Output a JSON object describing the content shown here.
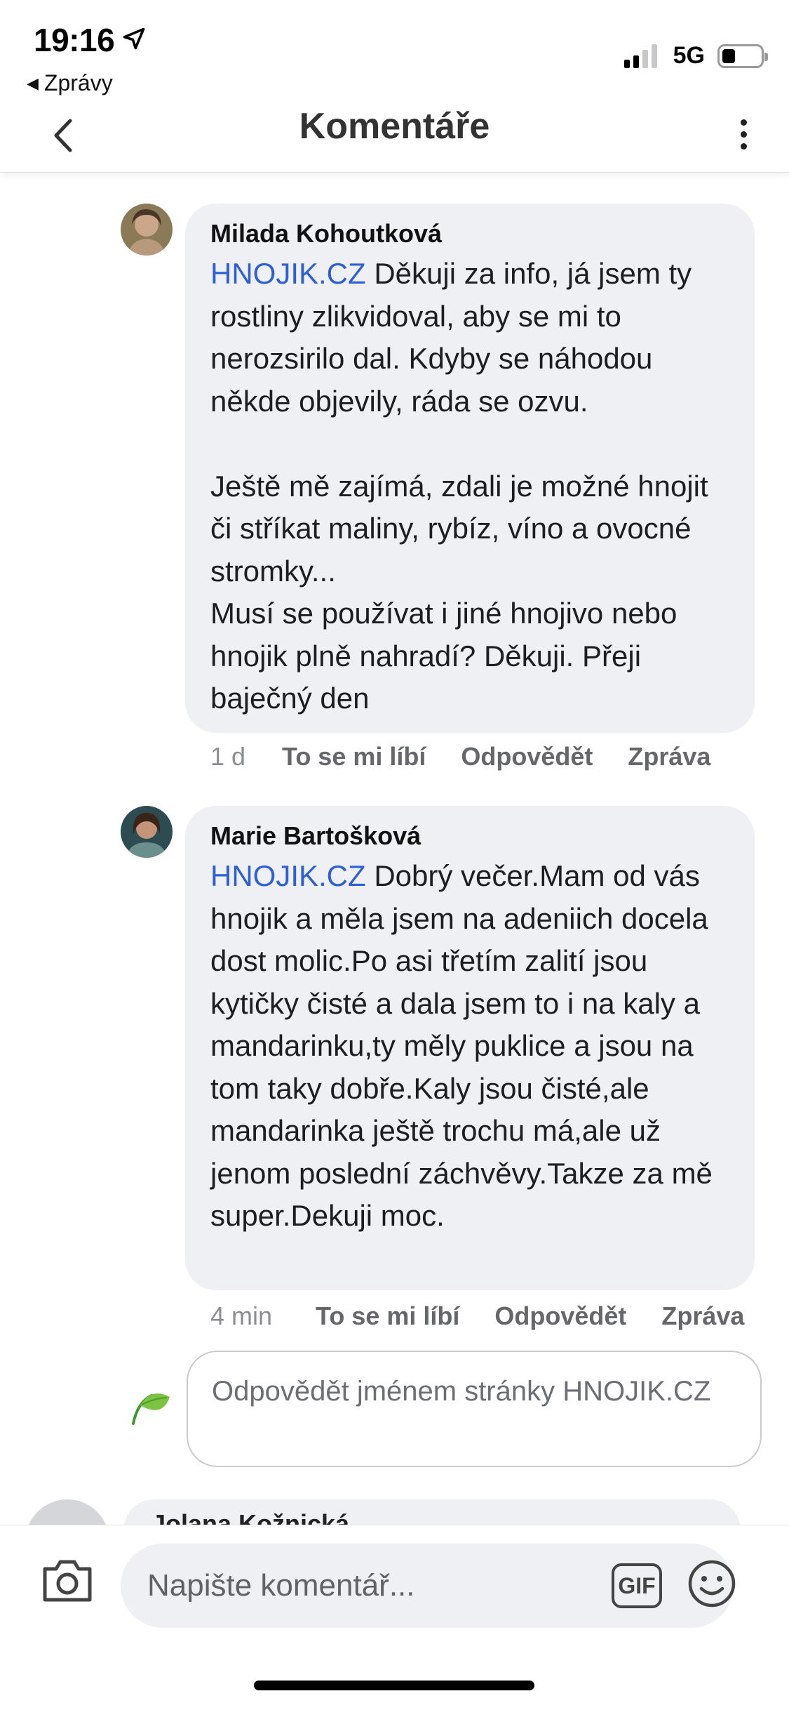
{
  "status_bar": {
    "time": "19:16",
    "back_app": "Zprávy",
    "network": "5G"
  },
  "header": {
    "title": "Komentáře"
  },
  "comments": [
    {
      "author": "Milada Kohoutková",
      "tag": "HNOJIK.CZ",
      "text": " Děkuji za info, já jsem ty rostliny zlikvidoval, aby se mi to nerozsirilo dal. Kdyby se náhodou někde objevily, ráda se ozvu.\n\nJeště mě zajímá, zdali je možné hnojit či stříkat maliny, rybíz, víno a ovocné stromky...\nMusí se používat i jiné hnojivo nebo hnojik plně nahradí? Děkuji. Přeji baječný den",
      "time": "1 d",
      "like": "To se mi líbí",
      "reply": "Odpovědět",
      "message": "Zpráva"
    },
    {
      "author": "Marie Bartošková",
      "tag": "HNOJIK.CZ",
      "text": " Dobrý večer.Mam od vás hnojik a měla jsem na adeniich docela dost molic.Po asi třetím zalití jsou kytičky čisté a dala jsem to i na kaly a mandarinku,ty měly puklice a jsou na tom taky dobře.Kaly jsou čisté,ale mandarinka ještě trochu má,ale už jenom poslední záchvěvy.Takze za mě super.Dekuji moc.",
      "time": "4 min",
      "like": "To se mi líbí",
      "reply": "Odpovědět",
      "message": "Zpráva"
    }
  ],
  "reply_box": {
    "text": "Odpovědět jménem stránky HNOJIK.CZ"
  },
  "next_comment": {
    "author_partial": "Jolana Kožnická"
  },
  "composer": {
    "placeholder": "Napište komentář...",
    "gif_label": "GIF"
  },
  "colors": {
    "tag_link": "#2e5fd9",
    "bubble_bg": "#eff0f3",
    "action_text": "#65676b"
  },
  "icons": [
    "location-arrow-icon",
    "signal-icon",
    "battery-icon",
    "chevron-left-icon",
    "more-vertical-icon",
    "leaf-icon",
    "camera-icon",
    "gif-icon",
    "smiley-icon"
  ]
}
